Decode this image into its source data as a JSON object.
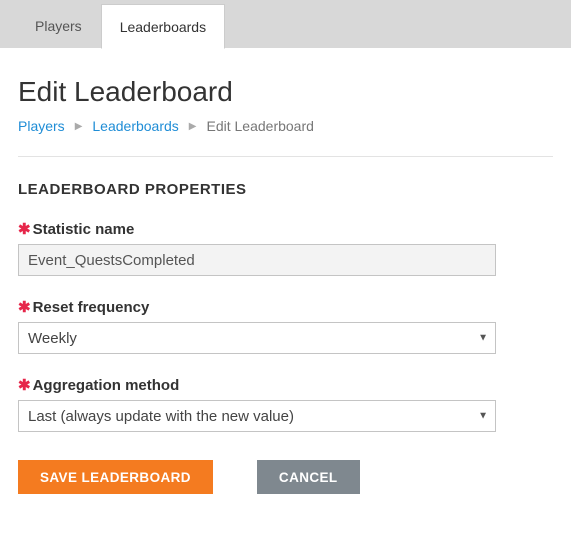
{
  "tabs": [
    {
      "label": "Players",
      "active": false
    },
    {
      "label": "Leaderboards",
      "active": true
    }
  ],
  "page_title": "Edit Leaderboard",
  "breadcrumb": {
    "items": [
      "Players",
      "Leaderboards"
    ],
    "current": "Edit Leaderboard"
  },
  "section_title": "LEADERBOARD PROPERTIES",
  "fields": {
    "statistic_name": {
      "label": "Statistic name",
      "value": "Event_QuestsCompleted",
      "required": true
    },
    "reset_frequency": {
      "label": "Reset frequency",
      "value": "Weekly",
      "required": true
    },
    "aggregation_method": {
      "label": "Aggregation method",
      "value": "Last (always update with the new value)",
      "required": true
    }
  },
  "buttons": {
    "save": "SAVE LEADERBOARD",
    "cancel": "CANCEL"
  },
  "required_marker": "✱"
}
